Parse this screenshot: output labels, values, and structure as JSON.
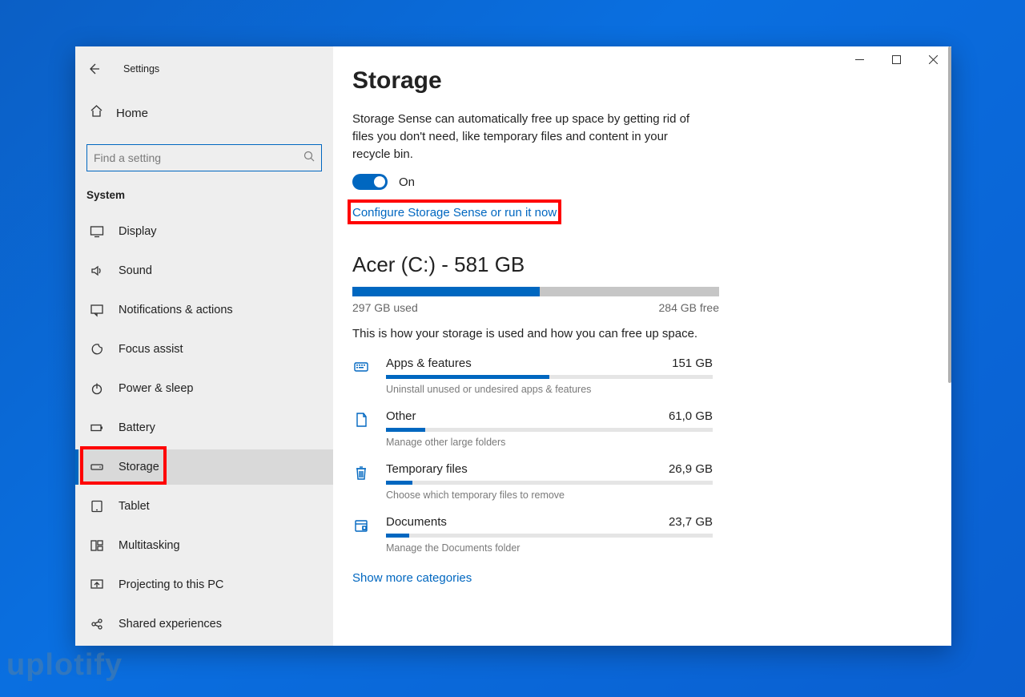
{
  "window": {
    "title": "Settings",
    "back_aria": "Back"
  },
  "sidebar": {
    "home_label": "Home",
    "search_placeholder": "Find a setting",
    "section_label": "System",
    "items": [
      {
        "icon": "display",
        "label": "Display"
      },
      {
        "icon": "sound",
        "label": "Sound"
      },
      {
        "icon": "notifications",
        "label": "Notifications & actions"
      },
      {
        "icon": "focus",
        "label": "Focus assist"
      },
      {
        "icon": "power",
        "label": "Power & sleep"
      },
      {
        "icon": "battery",
        "label": "Battery"
      },
      {
        "icon": "storage",
        "label": "Storage",
        "active": true
      },
      {
        "icon": "tablet",
        "label": "Tablet"
      },
      {
        "icon": "multitasking",
        "label": "Multitasking"
      },
      {
        "icon": "projecting",
        "label": "Projecting to this PC"
      },
      {
        "icon": "shared",
        "label": "Shared experiences"
      }
    ]
  },
  "page": {
    "title": "Storage",
    "sense_desc": "Storage Sense can automatically free up space by getting rid of files you don't need, like temporary files and content in your recycle bin.",
    "toggle_state": "On",
    "configure_link": "Configure Storage Sense or run it now",
    "drive": {
      "title": "Acer (C:) - 581 GB",
      "used_label": "297 GB used",
      "free_label": "284 GB free",
      "fill_percent": 51
    },
    "usage_desc": "This is how your storage is used and how you can free up space.",
    "categories": [
      {
        "icon": "apps",
        "name": "Apps & features",
        "size": "151 GB",
        "fill": 50,
        "hint": "Uninstall unused or undesired apps & features"
      },
      {
        "icon": "other",
        "name": "Other",
        "size": "61,0 GB",
        "fill": 12,
        "hint": "Manage other large folders"
      },
      {
        "icon": "temp",
        "name": "Temporary files",
        "size": "26,9 GB",
        "fill": 8,
        "hint": "Choose which temporary files to remove"
      },
      {
        "icon": "docs",
        "name": "Documents",
        "size": "23,7 GB",
        "fill": 7,
        "hint": "Manage the Documents folder"
      }
    ],
    "show_more": "Show more categories"
  },
  "watermark": "uplotify"
}
